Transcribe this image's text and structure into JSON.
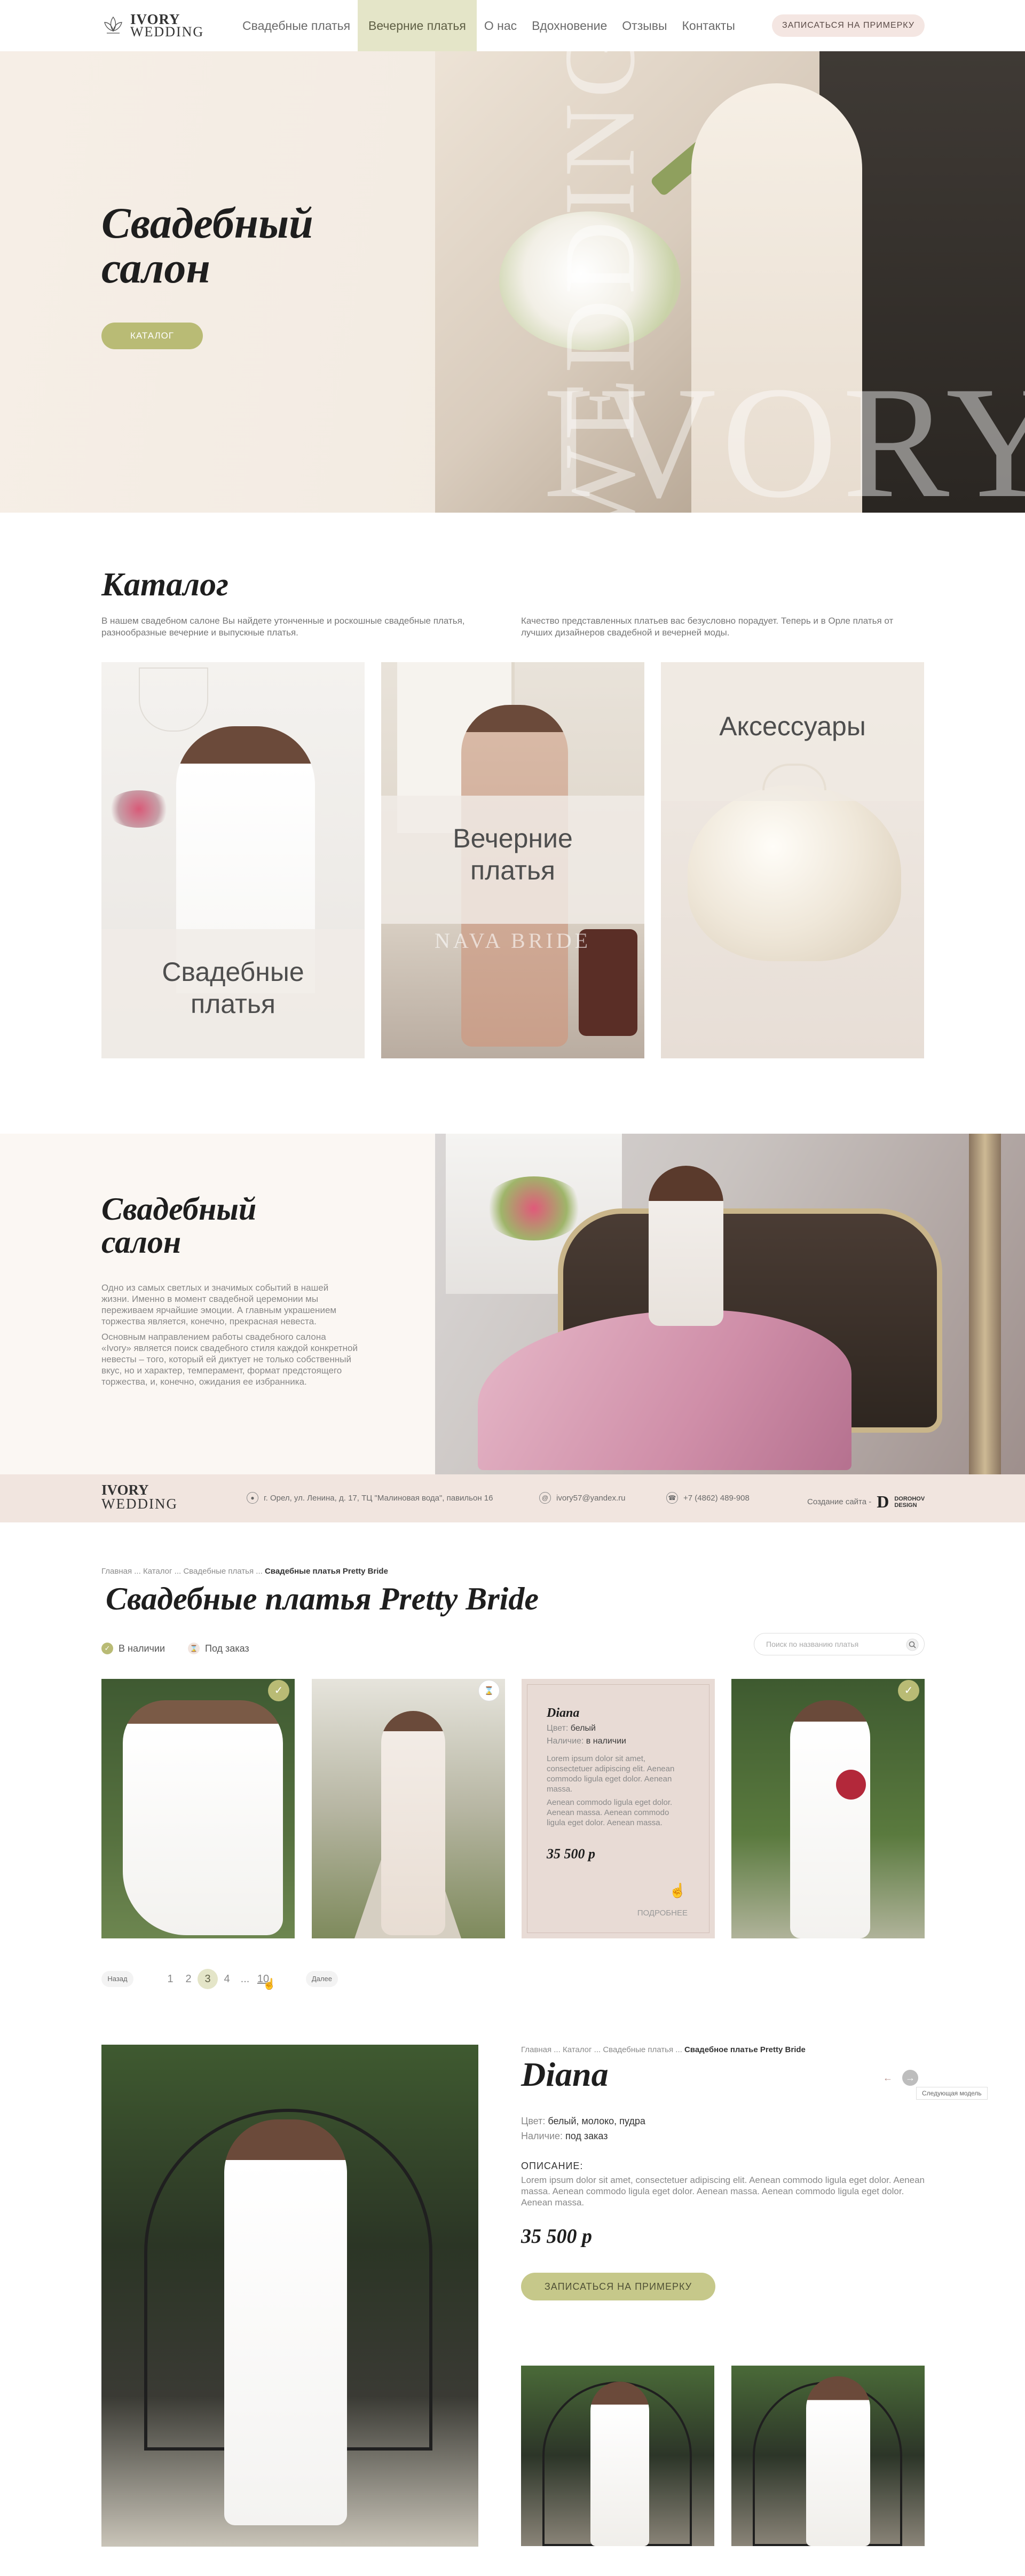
{
  "header": {
    "logo": {
      "line1": "IVORY",
      "line2": "WEDDING"
    },
    "nav": [
      {
        "label": "Свадебные платья"
      },
      {
        "label": "Вечерние платья"
      },
      {
        "label": "О нас"
      },
      {
        "label": "Вдохновение"
      },
      {
        "label": "Отзывы"
      },
      {
        "label": "Контакты"
      }
    ],
    "active_nav": "Вечерние платья",
    "cta": "ЗАПИСАТЬСЯ НА ПРИМЕРКУ"
  },
  "hero": {
    "title_line1": "Свадебный",
    "title_line2": "салон",
    "button": "КАТАЛОГ",
    "bg_word1": "WEDDING",
    "bg_word2": "IVORY"
  },
  "catalog": {
    "title": "Каталог",
    "desc_left": "В нашем свадебном салоне Вы найдете утонченные и роскошные свадебные платья, разнообразные вечерние и выпускные платья.",
    "desc_right": "Качество представленных платьев вас безусловно порадует. Теперь и в Орле платья от лучших дизайнеров свадебной и вечерней моды.",
    "cards": [
      {
        "label": "Свадебные платья"
      },
      {
        "label": "Вечерние платья",
        "watermark": "NAVA BRIDE"
      },
      {
        "label": "Аксессуары"
      }
    ]
  },
  "salon": {
    "title_line1": "Свадебный",
    "title_line2": "салон",
    "p1": "Одно из самых светлых и значимых событий в нашей жизни. Именно в момент свадебной церемонии мы переживаем ярчайшие эмоции. А главным украшением торжества является, конечно, прекрасная невеста.",
    "p2": "Основным направлением работы свадебного салона «Ivory» является поиск свадебного стиля каждой конкретной невесты – того, который ей диктует не только собственный вкус, но и характер, темперамент, формат предстоящего торжества, и, конечно, ожидания ее избранника."
  },
  "footer": {
    "logo_line1": "IVORY",
    "logo_line2": "WEDDING",
    "address": "г. Орел, ул. Ленина, д. 17, ТЦ \"Малиновая вода\", павильон 16",
    "email": "ivory57@yandex.ru",
    "phone": "+7 (4862) 489-908",
    "credit": "Создание сайта -",
    "studio_line1": "DOROHOV",
    "studio_line2": "DESIGN"
  },
  "listing": {
    "breadcrumb": [
      "Главная",
      "Каталог",
      "Свадебные платья"
    ],
    "breadcrumb_current": "Свадебные платья Pretty Bride",
    "breadcrumb_sep": "...",
    "title": "Свадебные платья Pretty Bride",
    "filter_in_stock": "В наличии",
    "filter_on_order": "Под заказ",
    "search_placeholder": "Поиск по названию платья",
    "hover_card": {
      "name": "Diana",
      "color_label": "Цвет:",
      "color_value": "белый",
      "avail_label": "Наличие:",
      "avail_value": "в наличии",
      "desc1": "Lorem ipsum dolor sit amet, consectetuer adipiscing elit. Aenean commodo ligula eget dolor. Aenean massa.",
      "desc2": "Aenean commodo ligula eget dolor. Aenean massa. Aenean commodo ligula eget dolor. Aenean massa.",
      "price": "35 500 р",
      "more": "ПОДРОБНЕЕ"
    },
    "pager": {
      "back": "Назад",
      "pages": [
        "1",
        "2",
        "3",
        "4"
      ],
      "dots": "...",
      "last": "10",
      "current": "3",
      "forward": "Далее"
    }
  },
  "detail": {
    "breadcrumb": [
      "Главная",
      "Каталог",
      "Свадебные платья"
    ],
    "breadcrumb_current": "Свадебное платье Pretty Bride",
    "breadcrumb_sep": "...",
    "title": "Diana",
    "color_label": "Цвет:",
    "color_value": "белый, молоко, пудра",
    "avail_label": "Наличие:",
    "avail_value": "под заказ",
    "desc_title": "ОПИСАНИЕ:",
    "desc": "Lorem ipsum dolor sit amet, consectetuer adipiscing elit. Aenean commodo ligula eget dolor. Aenean massa. Aenean commodo ligula eget dolor. Aenean massa. Aenean commodo ligula eget dolor. Aenean massa.",
    "price": "35 500 р",
    "button": "ЗАПИСАТЬСЯ НА ПРИМЕРКУ",
    "tooltip": "Следующая модель"
  },
  "colors": {
    "accent": "#b9bb75",
    "accent_light": "#e4e5c8",
    "blush": "#f1e5df",
    "text": "#1e1e1e"
  }
}
